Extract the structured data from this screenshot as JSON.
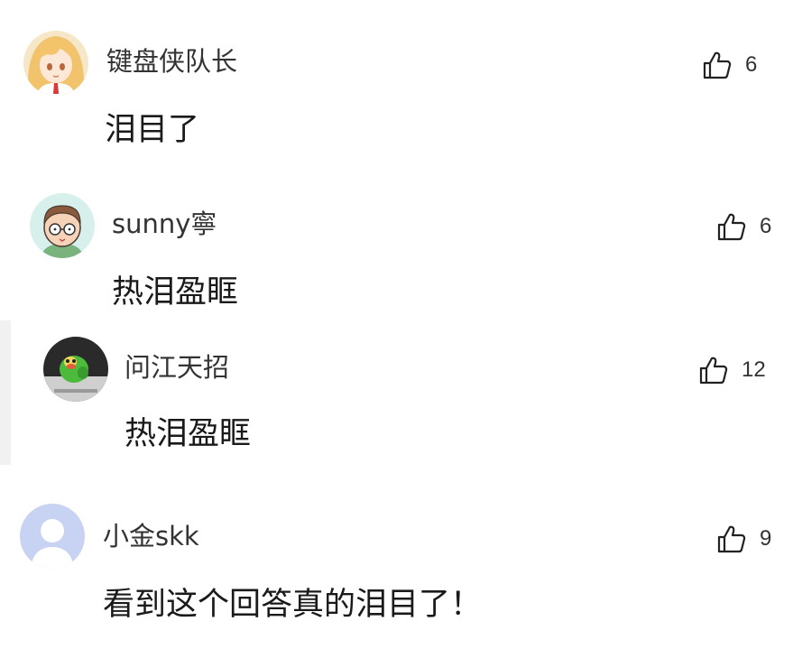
{
  "comments": [
    {
      "username": "键盘侠队长",
      "content": "泪目了",
      "likes": "6",
      "avatar": "anime-girl-avatar"
    },
    {
      "username": "sunny寧",
      "content": "热泪盈眶",
      "likes": "6",
      "avatar": "cartoon-man-glasses-avatar"
    },
    {
      "username": "问江天招",
      "content": "热泪盈眶",
      "likes": "12",
      "avatar": "green-toy-avatar",
      "is_reply": true
    },
    {
      "username": "小金skk",
      "content": "看到这个回答真的泪目了！",
      "likes": "9",
      "avatar": "default-user-avatar"
    }
  ],
  "icons": {
    "like": "thumbs-up-icon"
  },
  "colors": {
    "text": "#1a1a1a",
    "username": "#333333",
    "default_avatar": "#c8d3f3",
    "reply_bar": "#f1f1f1"
  }
}
